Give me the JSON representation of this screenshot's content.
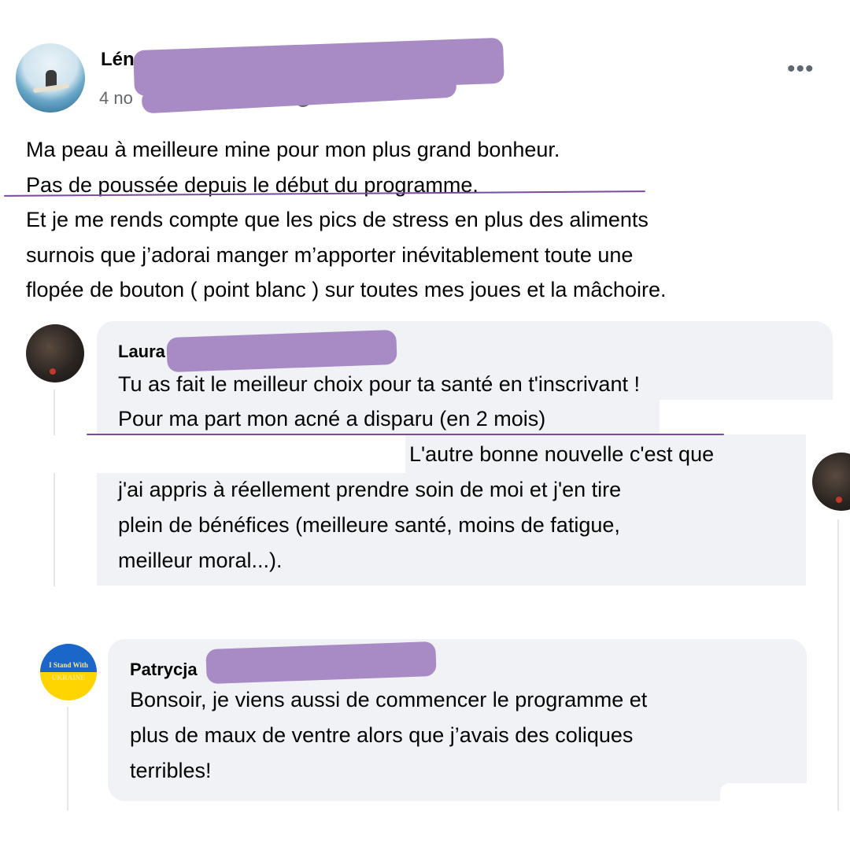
{
  "post": {
    "author": "Léno",
    "date": "4 no",
    "more_icon": "more-horizontal-icon",
    "lines": [
      "Ma peau à meilleure mine pour mon plus grand bonheur.",
      "Pas de poussée depuis le début du programme.",
      "Et je me rends compte que les pics de stress en plus des aliments",
      "surnois que j’adorai manger m’apporter inévitablement toute une",
      "flopée  de bouton ( point blanc ) sur toutes mes joues et la mâchoire."
    ]
  },
  "comments": [
    {
      "author": "Laura",
      "lines": [
        "Tu as fait le meilleur choix pour ta santé en t'inscrivant !",
        "Pour ma part mon acné a disparu (en 2 mois)",
        "L'autre bonne nouvelle c'est que",
        "j'ai appris à réellement prendre soin de moi et j'en tire",
        "plein de bénéfices (meilleure santé, moins de fatigue,",
        "meilleur moral...)."
      ]
    },
    {
      "author": "Patrycja",
      "avatar_text": [
        "I Stand With",
        "UKRAINE"
      ],
      "lines": [
        "Bonsoir, je viens aussi de commencer le programme et",
        "plus de maux de ventre alors que j’avais des coliques",
        "terribles!"
      ]
    }
  ],
  "colors": {
    "redaction": "#a88bc4",
    "underline": "#7a4a9c",
    "bubble": "#f0f2f5",
    "secondary_text": "#65676b"
  }
}
